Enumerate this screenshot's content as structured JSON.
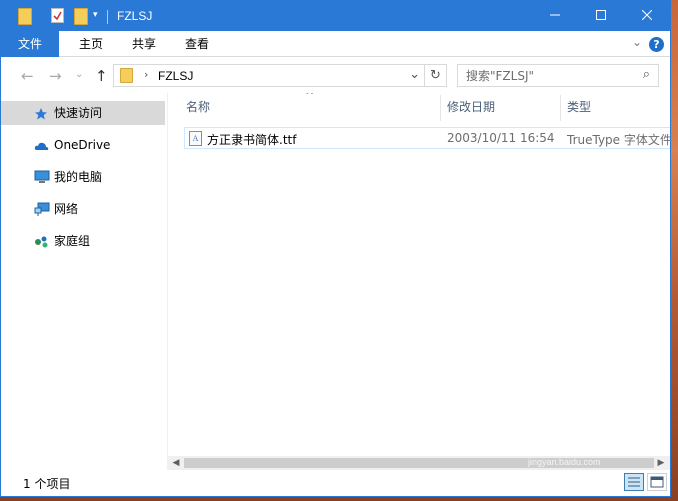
{
  "window": {
    "title": "FZLSJ",
    "controls": {
      "minimize_icon": "minimize-icon",
      "maximize_icon": "maximize-icon",
      "close_icon": "close-icon"
    }
  },
  "ribbon": {
    "tabs": [
      {
        "label": "文件"
      },
      {
        "label": "主页"
      },
      {
        "label": "共享"
      },
      {
        "label": "查看"
      }
    ],
    "help": "?"
  },
  "navigation": {
    "path": "FZLSJ",
    "search_placeholder": "搜索\"FZLSJ\""
  },
  "sidebar": {
    "items": [
      {
        "label": "快速访问",
        "icon": "star-icon"
      },
      {
        "label": "OneDrive",
        "icon": "cloud-icon"
      },
      {
        "label": "我的电脑",
        "icon": "computer-icon"
      },
      {
        "label": "网络",
        "icon": "network-icon"
      },
      {
        "label": "家庭组",
        "icon": "homegroup-icon"
      }
    ]
  },
  "file_list": {
    "columns": [
      {
        "label": "名称"
      },
      {
        "label": "修改日期"
      },
      {
        "label": "类型"
      }
    ],
    "rows": [
      {
        "name": "方正隶书简体.ttf",
        "modified": "2003/10/11 16:54",
        "type": "TrueType 字体文件"
      }
    ]
  },
  "status": {
    "count": "1 个项目"
  },
  "watermark": {
    "brand": "Baidu",
    "sub": "jingyan.baidu.com"
  },
  "colors": {
    "accent": "#2b79d7",
    "selection_border": "#cde8ff",
    "sidebar_active": "#d9d9d9"
  }
}
